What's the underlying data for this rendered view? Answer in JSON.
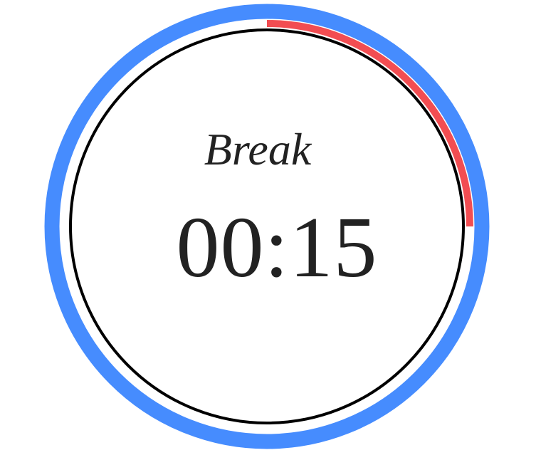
{
  "timer": {
    "mode": "Break",
    "time": "00:15",
    "progress_fraction": 0.25,
    "colors": {
      "outer_ring": "#468cfe",
      "progress_arc": "#f24d52",
      "inner_ring": "#000000",
      "text": "#222222",
      "background": "#ffffff"
    }
  }
}
